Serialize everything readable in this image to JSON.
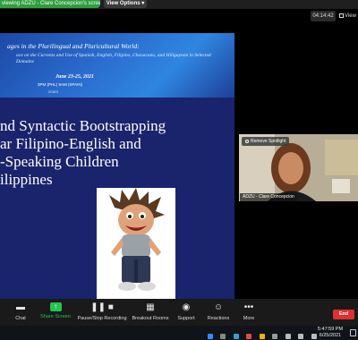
{
  "share_banner": {
    "status_text": "viewing ADZU - Clare Concepcion's screen",
    "view_options_label": "View Options ▾"
  },
  "meeting": {
    "elapsed_time": "04:14:42",
    "view_label": "View"
  },
  "slide": {
    "header_title": "ages in the Plurilingual and Pluricultural World:",
    "header_subtitle": "ace on the Currents and Use of Spanish, English, Filipino, Chavacano, and Hiligaynon in Selected Domains",
    "header_date": "June 23-25, 2021",
    "header_times": "3PM (PHL)     9AM (SPAIN)",
    "header_platform": "zoom",
    "title_lines": [
      "nd Syntactic Bootstrapping",
      "ar Filipino-English and",
      "-Speaking Children",
      "ilippines"
    ]
  },
  "participant": {
    "spotlight_label": "Remove Spotlight",
    "name": "ADZU - Clare Concepcion"
  },
  "toolbar": {
    "chat_label": "Chat",
    "share_screen_label": "Share Screen",
    "record_label": "Pause/Stop Recording",
    "breakout_label": "Breakout Rooms",
    "support_label": "Support",
    "reactions_label": "Reactions",
    "more_label": "More",
    "end_label": "End"
  },
  "taskbar": {
    "time": "5:47:59 PM",
    "date": "6/25/2021"
  },
  "colors": {
    "share_green": "#2f9e3f",
    "end_red": "#e02f2f",
    "slide_blue": "#1a246c"
  }
}
